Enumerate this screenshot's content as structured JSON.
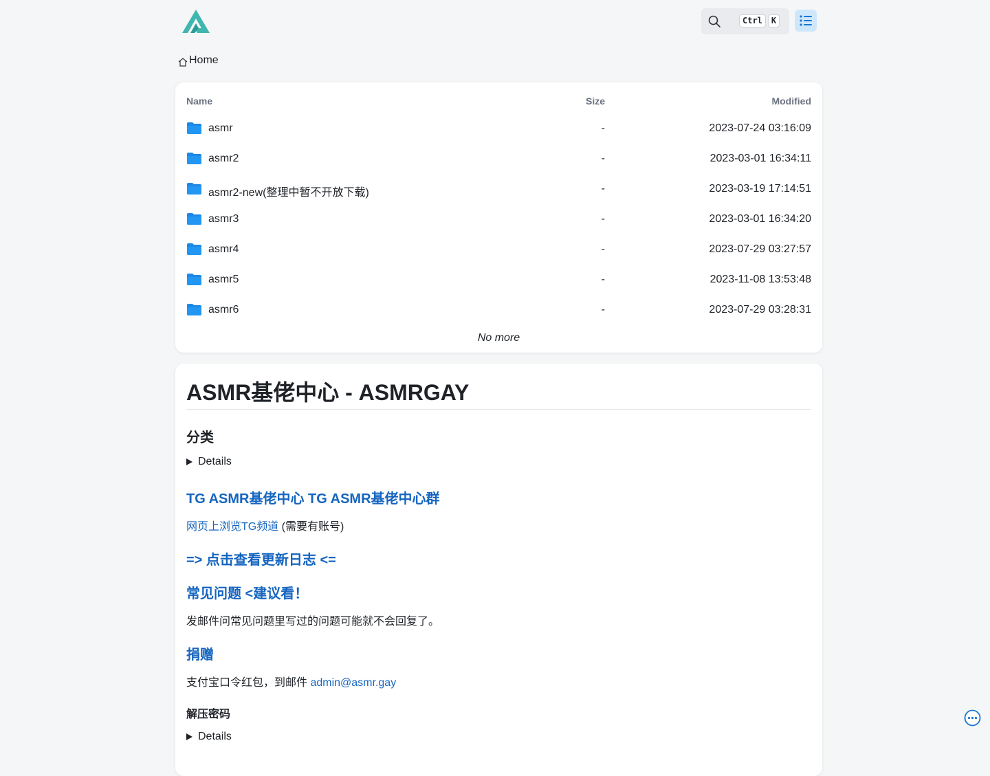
{
  "header": {
    "search_keys": [
      "Ctrl",
      "K"
    ]
  },
  "breadcrumb": {
    "home_label": "Home"
  },
  "list": {
    "columns": {
      "name": "Name",
      "size": "Size",
      "modified": "Modified"
    },
    "rows": [
      {
        "name": "asmr",
        "size": "-",
        "modified": "2023-07-24 03:16:09"
      },
      {
        "name": "asmr2",
        "size": "-",
        "modified": "2023-03-01 16:34:11"
      },
      {
        "name": "asmr2-new(整理中暂不开放下载)",
        "size": "-",
        "modified": "2023-03-19 17:14:51"
      },
      {
        "name": "asmr3",
        "size": "-",
        "modified": "2023-03-01 16:34:20"
      },
      {
        "name": "asmr4",
        "size": "-",
        "modified": "2023-07-29 03:27:57"
      },
      {
        "name": "asmr5",
        "size": "-",
        "modified": "2023-11-08 13:53:48"
      },
      {
        "name": "asmr6",
        "size": "-",
        "modified": "2023-07-29 03:28:31"
      }
    ],
    "footer": "No more"
  },
  "readme": {
    "title": "ASMR基佬中心 - ASMRGAY",
    "category_heading": "分类",
    "details_label": "Details",
    "tg_channel_link": "TG ASMR基佬中心",
    "tg_group_link": "TG ASMR基佬中心群",
    "web_tg_link": "网页上浏览TG频道",
    "web_tg_note": " (需要有账号)",
    "changelog_link": "=> 点击查看更新日志 <=",
    "faq_link": "常见问题 <建议看！",
    "faq_note": "发邮件问常见问题里写过的问题可能就不会回复了。",
    "donate_link": "捐赠",
    "donate_text": "支付宝口令红包，到邮件 ",
    "email": "admin@asmr.gay",
    "password_heading": "解压密码",
    "details_label_2": "Details"
  },
  "colors": {
    "accent": "#1565c0",
    "folder": "#1e88e5",
    "background": "#f5f6f7",
    "logo": "#3fb7b0"
  }
}
